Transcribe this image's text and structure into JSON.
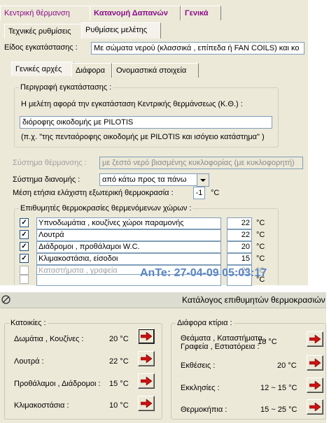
{
  "top_tabs": [
    "Κεντρική θέρμανση",
    "Κατανομή Δαπανών",
    "Γενικά"
  ],
  "sub_tabs": [
    "Τεχνικές ρυθμίσεις",
    "Ρυθμίσεις μελέτης"
  ],
  "install_type_label": "Είδος εγκατάστασης :",
  "install_type_value": "Με σώματα νερού (κλασσικά , επίπεδα ή FAN COILS) και κο",
  "inner_tabs": [
    "Γενικές αρχές",
    "Διάφορα",
    "Ονομαστικά στοιχεία"
  ],
  "description_group": {
    "title": "Περιγραφή εγκατάστασης :",
    "prompt": "Η μελέτη αφορά την εγκατάσταση Κεντρικής θερμάνσεως (Κ.Θ.) :",
    "value": "διόροφης οικοδομής με PILOTIS",
    "example": "(π.χ. \"της πενταόροφης οικοδομής με PILOTIS και ισόγειο κατάστημα\" )"
  },
  "heating_system_label": "Σύστημα θέρμανσης :",
  "heating_system_value": "με ζεστό νερό βιασμένης κυκλοφορίας (με κυκλοφορητή)",
  "distribution_label": "Σύστημα διανομής :",
  "distribution_value": "από κάτω προς τα πάνω",
  "min_temp_label": "Μέση ετήσια ελάχιστη εξωτερική θερμοκρασία :",
  "min_temp_value": "-1",
  "min_temp_unit": "°C",
  "desired_group": {
    "title": "Επιθυμητές θερμοκρασίες θερμενόμενων χώρων :",
    "rows": [
      {
        "checked": true,
        "name": "Υπνοδωμάτια , κουζίνες χώροι παραμονής",
        "value": "22",
        "unit": "°C"
      },
      {
        "checked": true,
        "name": "Λουτρά",
        "value": "22",
        "unit": "°C"
      },
      {
        "checked": true,
        "name": "Διάδρομοι , προθάλαμοι W.C.",
        "value": "20",
        "unit": "°C"
      },
      {
        "checked": true,
        "name": "Κλιμακοστάσια, είσοδοι",
        "value": "15",
        "unit": "°C"
      },
      {
        "checked": false,
        "name": "Καταστήματα , γραφεία",
        "value": "20",
        "unit": "°C"
      },
      {
        "checked": false,
        "name": "",
        "value": "",
        "unit": "°C"
      }
    ]
  },
  "watermark": "AnTe: 27-04-09 05:03:17",
  "bottom_title": "Κατάλογος επιθυμητών θερμοκρασιών",
  "homes_group": {
    "title": "Κατοικίες :",
    "rows": [
      {
        "name": "Δωμάτια , Κουζίνες :",
        "value": "20 °C"
      },
      {
        "name": "Λουτρά :",
        "value": "22 °C"
      },
      {
        "name": "Προθάλαμοι , Διάδρομοι :",
        "value": "15 °C"
      },
      {
        "name": "Κλιμακοστάσια :",
        "value": "10 °C"
      }
    ]
  },
  "other_group": {
    "title": "Διάφορα κτίρια :",
    "rows": [
      {
        "name": "Θεάματα , Καταστήματα , Γραφεία , Εστιατόρεια :",
        "value": "18 °C"
      },
      {
        "name": "Εκθέσεις :",
        "value": "20 °C"
      },
      {
        "name": "Εκκλησίες :",
        "value": "12 ~ 15 °C"
      },
      {
        "name": "Θερμοκήπια :",
        "value": "15 ~ 25 °C"
      }
    ]
  },
  "colors": {
    "accent": "#8a0e8a",
    "panel": "#ece9d8",
    "arrow": "#cc1111",
    "watermark": "#5a86c9"
  }
}
